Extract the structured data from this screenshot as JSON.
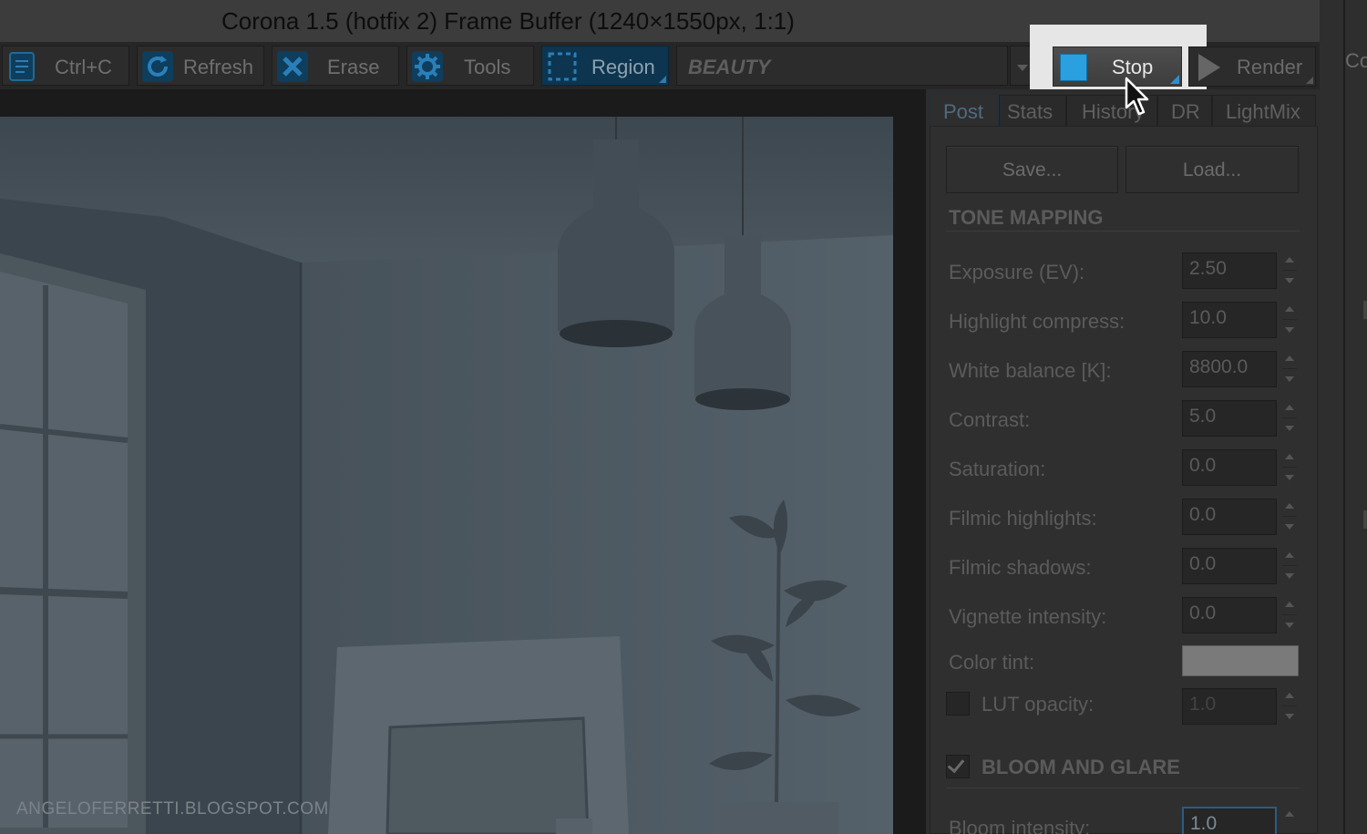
{
  "window": {
    "title": "Corona 1.5 (hotfix 2) Frame Buffer (1240×1550px, 1:1)",
    "right_edge_partial": "Co"
  },
  "toolbar": {
    "copy_label": "Ctrl+C",
    "refresh_label": "Refresh",
    "erase_label": "Erase",
    "tools_label": "Tools",
    "region_label": "Region",
    "pass_select": "BEAUTY",
    "stop_label": "Stop",
    "render_label": "Render",
    "stop_accent": "#2aa0e0"
  },
  "tabs": [
    "Post",
    "Stats",
    "History",
    "DR",
    "LightMix"
  ],
  "active_tab": "Post",
  "post": {
    "save_label": "Save...",
    "load_label": "Load...",
    "tone_mapping": {
      "title": "TONE MAPPING",
      "fields": [
        {
          "label": "Exposure (EV):",
          "value": "2.50"
        },
        {
          "label": "Highlight compress:",
          "value": "10.0"
        },
        {
          "label": "White balance [K]:",
          "value": "8800.0"
        },
        {
          "label": "Contrast:",
          "value": "5.0"
        },
        {
          "label": "Saturation:",
          "value": "0.0"
        },
        {
          "label": "Filmic highlights:",
          "value": "0.0"
        },
        {
          "label": "Filmic shadows:",
          "value": "0.0"
        },
        {
          "label": "Vignette intensity:",
          "value": "0.0"
        }
      ],
      "color_tint_label": "Color tint:",
      "color_tint_value": "#7a7a7a",
      "lut_label": "LUT opacity:",
      "lut_value": "1.0",
      "lut_enabled": false
    },
    "bloom": {
      "title": "BLOOM AND GLARE",
      "enabled": true,
      "intensity_label": "Bloom intensity:",
      "intensity_value": "1.0"
    }
  },
  "viewport": {
    "watermark": "ANGELOFERRETTI.BLOGSPOT.COM"
  }
}
